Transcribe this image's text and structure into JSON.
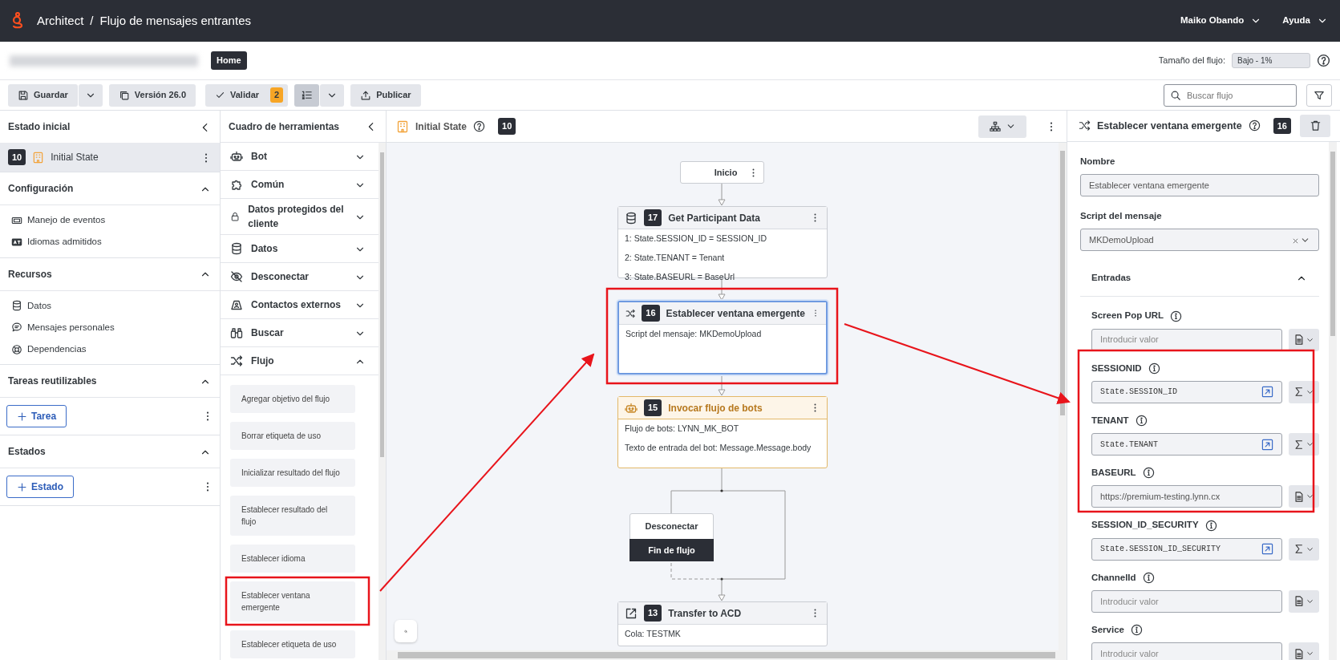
{
  "header": {
    "app": "Architect",
    "separator": "/",
    "flow_title": "Flujo de mensajes entrantes",
    "user": "Maiko Obando",
    "help": "Ayuda"
  },
  "subheader": {
    "tag": "Home",
    "flow_size_label": "Tamaño del flujo:",
    "flow_size_value": "Bajo - 1%"
  },
  "toolbar": {
    "save": "Guardar",
    "version": "Versión 26.0",
    "validate": "Validar",
    "validate_count": "2",
    "list_view_selected": true,
    "publish": "Publicar",
    "search_placeholder": "Buscar flujo"
  },
  "left_panel": {
    "title": "Estado inicial",
    "initial_state": {
      "number": "10",
      "label": "Initial State",
      "selected": true
    },
    "sections": [
      {
        "title": "Configuración",
        "expanded": true,
        "items": [
          "Manejo de eventos",
          "Idiomas admitidos"
        ]
      },
      {
        "title": "Recursos",
        "expanded": true,
        "items": [
          "Datos",
          "Mensajes personales",
          "Dependencias"
        ]
      },
      {
        "title": "Tareas reutilizables",
        "expanded": true,
        "button": "Tarea"
      },
      {
        "title": "Estados",
        "expanded": true,
        "button": "Estado"
      }
    ]
  },
  "toolbox": {
    "title": "Cuadro de herramientas",
    "categories": [
      {
        "label": "Bot",
        "expanded": false
      },
      {
        "label": "Común",
        "expanded": false
      },
      {
        "label": "Datos protegidos del cliente",
        "expanded": false
      },
      {
        "label": "Datos",
        "expanded": false
      },
      {
        "label": "Desconectar",
        "expanded": false
      },
      {
        "label": "Contactos externos",
        "expanded": false
      },
      {
        "label": "Buscar",
        "expanded": false
      },
      {
        "label": "Flujo",
        "expanded": true,
        "items": [
          "Agregar objetivo del flujo",
          "Borrar etiqueta de uso",
          "Inicializar resultado del flujo",
          "Establecer resultado del flujo",
          "Establecer idioma",
          "Establecer ventana emergente",
          "Establecer etiqueta de uso"
        ]
      }
    ]
  },
  "canvas": {
    "title": "Initial State",
    "number": "10",
    "nodes": [
      {
        "kind": "start",
        "title": "Inicio"
      },
      {
        "kind": "action",
        "number": "17",
        "title": "Get Participant Data",
        "selected": false,
        "lines": [
          "1: State.SESSION_ID = SESSION_ID",
          "2: State.TENANT = Tenant",
          "3: State.BASEURL = BaseUrl"
        ]
      },
      {
        "kind": "action",
        "number": "16",
        "title": "Establecer ventana emergente",
        "selected": true,
        "lines": [
          "Script del mensaje: MKDemoUpload"
        ]
      },
      {
        "kind": "bot",
        "number": "15",
        "title": "Invocar flujo de bots",
        "selected": false,
        "lines": [
          "Flujo de bots: LYNN_MK_BOT",
          "Texto de entrada del bot: Message.Message.body"
        ]
      },
      {
        "kind": "terminal",
        "title": "Desconectar",
        "footer": "Fin de flujo"
      },
      {
        "kind": "action",
        "number": "13",
        "title": "Transfer to ACD",
        "selected": false,
        "lines": [
          "Cola: TESTMK"
        ]
      }
    ]
  },
  "properties": {
    "title": "Establecer ventana emergente",
    "number": "16",
    "name_label": "Nombre",
    "name_value": "Establecer ventana emergente",
    "script_label": "Script del mensaje",
    "script_value": "MKDemoUpload",
    "inputs_title": "Entradas",
    "inputs_expanded": true,
    "inputs": [
      {
        "label": "Screen Pop URL",
        "kind": "literal",
        "placeholder": "Introducir valor"
      },
      {
        "label": "SESSIONID",
        "kind": "expression",
        "value": "State.SESSION_ID"
      },
      {
        "label": "TENANT",
        "kind": "expression",
        "value": "State.TENANT"
      },
      {
        "label": "BASEURL",
        "kind": "literal",
        "value": "https://premium-testing.lynn.cx"
      },
      {
        "label": "SESSION_ID_SECURITY",
        "kind": "expression",
        "value": "State.SESSION_ID_SECURITY"
      },
      {
        "label": "ChannelId",
        "kind": "literal",
        "placeholder": "Introducir valor"
      },
      {
        "label": "Service",
        "kind": "literal",
        "placeholder": "Introducir valor"
      }
    ]
  }
}
